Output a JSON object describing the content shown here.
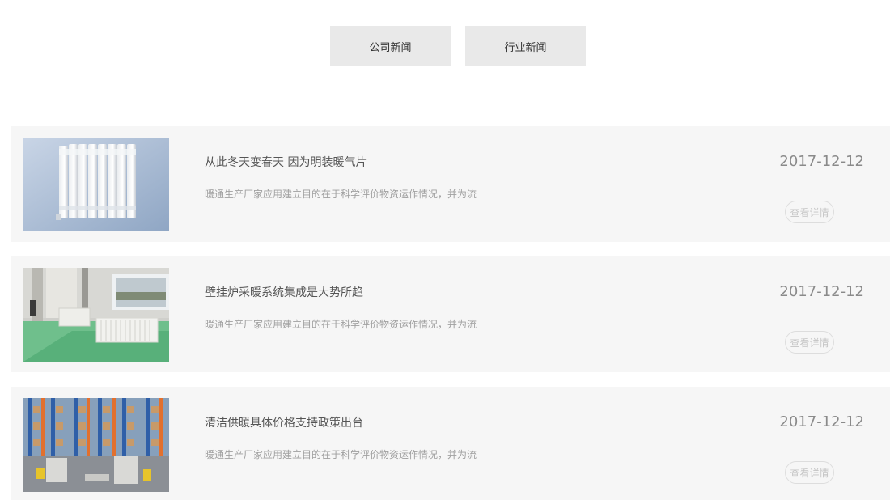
{
  "tabs": [
    {
      "label": "公司新闻"
    },
    {
      "label": "行业新闻"
    }
  ],
  "news": [
    {
      "title": "从此冬天变春天 因为明装暖气片",
      "desc": "暖通生产厂家应用建立目的在于科学评价物资运作情况，并为流",
      "date": "2017-12-12",
      "more": "查看详情",
      "image": "radiator-photo"
    },
    {
      "title": "壁挂炉采暖系统集成是大势所趋",
      "desc": "暖通生产厂家应用建立目的在于科学评价物资运作情况，并为流",
      "date": "2017-12-12",
      "more": "查看详情",
      "image": "room-radiator-photo"
    },
    {
      "title": "清洁供暖具体价格支持政策出台",
      "desc": "暖通生产厂家应用建立目的在于科学评价物资运作情况，并为流",
      "date": "2017-12-12",
      "more": "查看详情",
      "image": "warehouse-photo"
    }
  ]
}
